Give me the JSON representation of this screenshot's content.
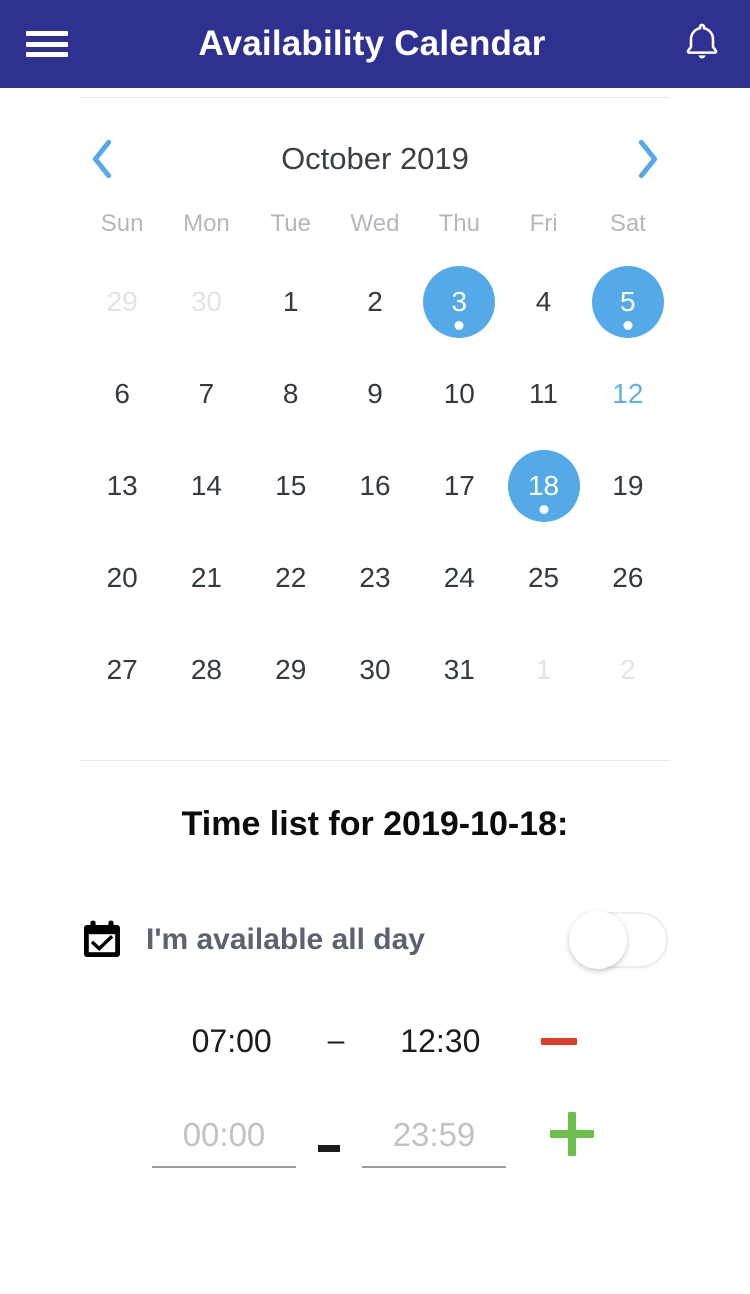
{
  "appbar": {
    "menu_icon": "hamburger-menu-icon",
    "title": "Availability Calendar",
    "notification_icon": "bell-icon"
  },
  "calendar": {
    "prev_label": "‹",
    "next_label": "›",
    "month_label": "October 2019",
    "weekdays": [
      "Sun",
      "Mon",
      "Tue",
      "Wed",
      "Thu",
      "Fri",
      "Sat"
    ],
    "selected_color": "#54A9E8",
    "today_color": "#62b0ea",
    "muted_color": "#e2e5e7",
    "days": [
      {
        "label": "29",
        "state": "muted"
      },
      {
        "label": "30",
        "state": "muted"
      },
      {
        "label": "1",
        "state": "normal"
      },
      {
        "label": "2",
        "state": "normal"
      },
      {
        "label": "3",
        "state": "marked"
      },
      {
        "label": "4",
        "state": "normal"
      },
      {
        "label": "5",
        "state": "marked"
      },
      {
        "label": "6",
        "state": "normal"
      },
      {
        "label": "7",
        "state": "normal"
      },
      {
        "label": "8",
        "state": "normal"
      },
      {
        "label": "9",
        "state": "normal"
      },
      {
        "label": "10",
        "state": "normal"
      },
      {
        "label": "11",
        "state": "normal"
      },
      {
        "label": "12",
        "state": "today"
      },
      {
        "label": "13",
        "state": "normal"
      },
      {
        "label": "14",
        "state": "normal"
      },
      {
        "label": "15",
        "state": "normal"
      },
      {
        "label": "16",
        "state": "normal"
      },
      {
        "label": "17",
        "state": "normal"
      },
      {
        "label": "18",
        "state": "marked"
      },
      {
        "label": "19",
        "state": "normal"
      },
      {
        "label": "20",
        "state": "normal"
      },
      {
        "label": "21",
        "state": "normal"
      },
      {
        "label": "22",
        "state": "normal"
      },
      {
        "label": "23",
        "state": "normal"
      },
      {
        "label": "24",
        "state": "normal"
      },
      {
        "label": "25",
        "state": "normal"
      },
      {
        "label": "26",
        "state": "normal"
      },
      {
        "label": "27",
        "state": "normal"
      },
      {
        "label": "28",
        "state": "normal"
      },
      {
        "label": "29",
        "state": "normal"
      },
      {
        "label": "30",
        "state": "normal"
      },
      {
        "label": "31",
        "state": "normal"
      },
      {
        "label": "1",
        "state": "muted"
      },
      {
        "label": "2",
        "state": "muted"
      }
    ]
  },
  "timelist": {
    "title": "Time list for 2019-10-18:",
    "allday": {
      "icon": "calendar-check-icon",
      "label": "I'm available all day",
      "toggle_state": "off"
    },
    "slots": [
      {
        "start": "07:00",
        "separator": "–",
        "end": "12:30",
        "remove_icon": "minus-icon",
        "remove_color": "#D9402B"
      }
    ],
    "new_slot": {
      "start_value": "",
      "start_placeholder": "00:00",
      "separator": "–",
      "end_value": "",
      "end_placeholder": "23:59",
      "add_icon": "plus-icon",
      "add_color": "#6CBF4B"
    }
  }
}
